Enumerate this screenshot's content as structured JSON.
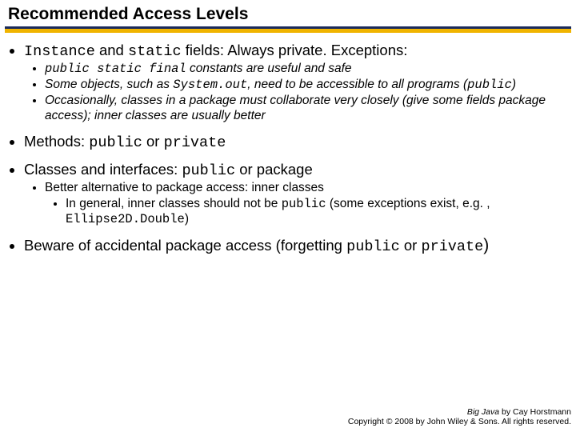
{
  "title": "Recommended Access Levels",
  "points": {
    "p1_a": "Instance",
    "p1_b": " and ",
    "p1_c": "static",
    "p1_d": " fields: Always private. Exceptions:",
    "p1s1_a": "public static final",
    "p1s1_b": " constants are useful and safe",
    "p1s2_a": "Some objects, such as ",
    "p1s2_b": "System.out",
    "p1s2_c": ", need to be accessible to all programs (",
    "p1s2_d": "public",
    "p1s2_e": ")",
    "p1s3": "Occasionally, classes in a package must collaborate very closely (give some fields package access); inner classes are usually better",
    "p2_a": "Methods: ",
    "p2_b": "public",
    "p2_c": " or ",
    "p2_d": "private",
    "p3_a": "Classes and interfaces: ",
    "p3_b": "public",
    "p3_c": " or package",
    "p3s1": "Better alternative to package access: inner classes",
    "p3s1s1_a": "In general, inner classes should not be ",
    "p3s1s1_b": "public",
    "p3s1s1_c": " (some exceptions exist, e.g. , ",
    "p3s1s1_d": "Ellipse2D.Double",
    "p3s1s1_e": ")",
    "p4_a": "Beware of accidental package access (forgetting ",
    "p4_b": "public",
    "p4_c": " or ",
    "p4_d": "private",
    "p4_e": ")"
  },
  "footer": {
    "book": "Big Java",
    "author": " by Cay Horstmann",
    "copyright": "Copyright © 2008 by John Wiley & Sons.  All rights reserved."
  }
}
